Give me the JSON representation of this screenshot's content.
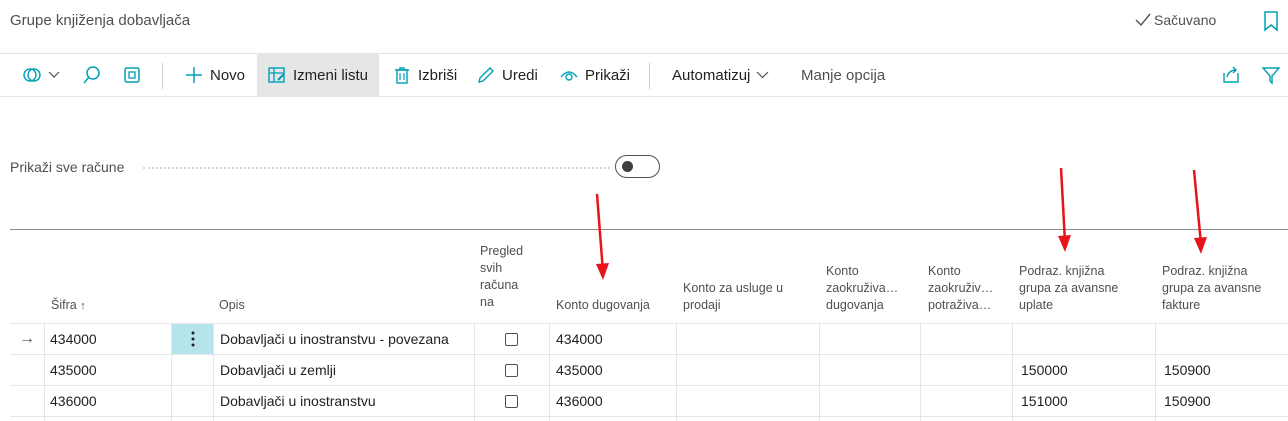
{
  "title": "Grupe knjiženja dobavljača",
  "status": {
    "saved_label": "Sačuvano"
  },
  "icons": {
    "check": "checkmark-icon",
    "bookmark": "bookmark-icon",
    "edit_in_excel": "people-switch-icon",
    "search": "search-icon",
    "open_in_new": "open-window-icon",
    "new": "plus-icon",
    "edit_list": "edit-list-icon",
    "delete": "trash-icon",
    "edit": "pencil-icon",
    "view": "eye-icon",
    "chevron": "chevron-down-icon",
    "share": "share-icon",
    "filter": "filter-icon"
  },
  "toolbar": {
    "new_label": "Novo",
    "edit_list_label": "Izmeni listu",
    "delete_label": "Izbriši",
    "edit_label": "Uredi",
    "view_label": "Prikaži",
    "automate_label": "Automatizuj",
    "fewer_options_label": "Manje opcija"
  },
  "show_all_accounts": {
    "label": "Prikaži sve račune",
    "value": false
  },
  "table": {
    "headers": {
      "code": "Šifra",
      "description": "Opis",
      "view_all_line1": "Pregled",
      "view_all_line2": "svih",
      "view_all_line3": "računa",
      "view_all_line4": "na",
      "payables": "Konto dugovanja",
      "service_charge_line1": "Konto za usluge u",
      "service_charge_line2": "prodaji",
      "inv_rounding_debit_line1": "Konto",
      "inv_rounding_debit_line2": "zaokruživa…",
      "inv_rounding_debit_line3": "dugovanja",
      "inv_rounding_credit_line1": "Konto",
      "inv_rounding_credit_line2": "zaokruživ…",
      "inv_rounding_credit_line3": "potraživa…",
      "prepay_payment_line1": "Podraz. knjižna",
      "prepay_payment_line2": "grupa za avansne",
      "prepay_payment_line3": "uplate",
      "prepay_invoice_line1": "Podraz. knjižna",
      "prepay_invoice_line2": "grupa za avansne",
      "prepay_invoice_line3": "fakture"
    },
    "rows": [
      {
        "code": "434000",
        "description": "Dobavljači u inostranstvu - povezana",
        "view_all": false,
        "payables": "434000",
        "service": "",
        "rnd_debit": "",
        "rnd_credit": "",
        "prepay_payment": "",
        "prepay_invoice": ""
      },
      {
        "code": "435000",
        "description": "Dobavljači u zemlji",
        "view_all": false,
        "payables": "435000",
        "service": "",
        "rnd_debit": "",
        "rnd_credit": "",
        "prepay_payment": "150000",
        "prepay_invoice": "150900"
      },
      {
        "code": "436000",
        "description": "Dobavljači u inostranstvu",
        "view_all": false,
        "payables": "436000",
        "service": "",
        "rnd_debit": "",
        "rnd_credit": "",
        "prepay_payment": "151000",
        "prepay_invoice": "150900"
      }
    ]
  },
  "colors": {
    "accent": "#00a0b4",
    "annotation_arrow": "#e8141c",
    "selected_row_menu": "#b6e4ec"
  }
}
